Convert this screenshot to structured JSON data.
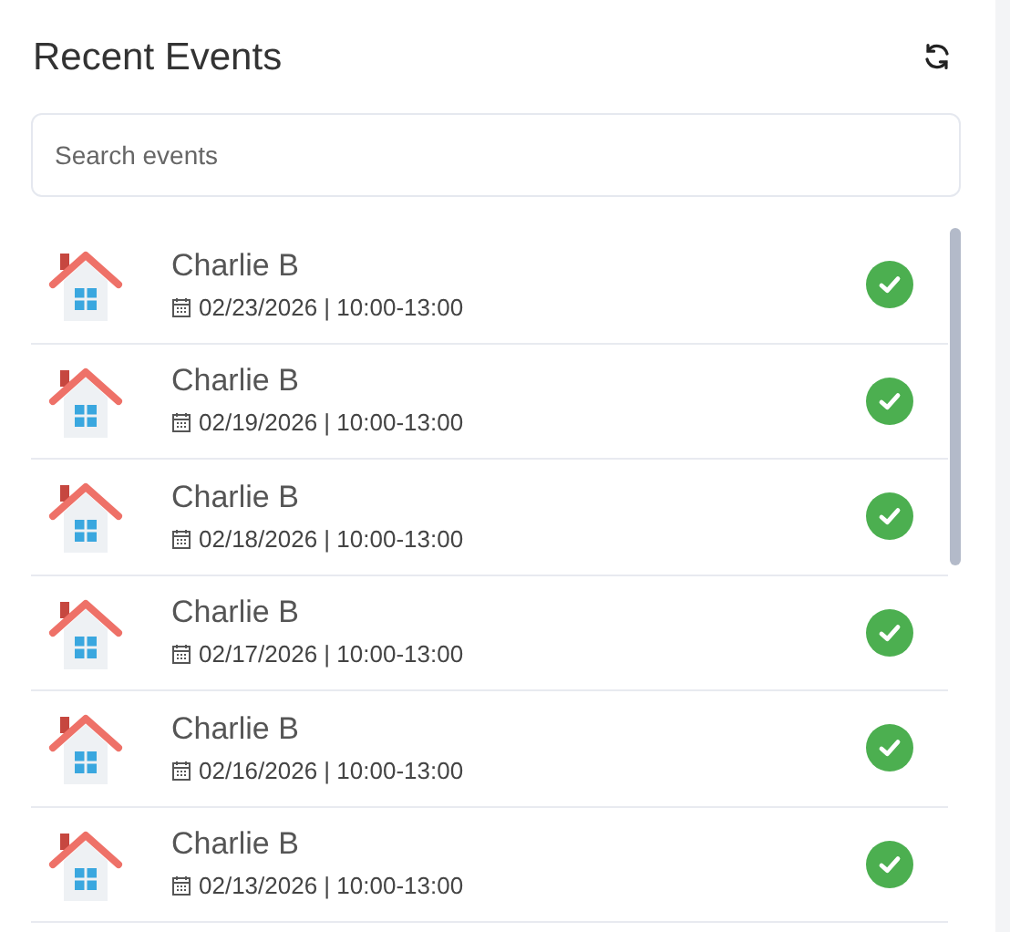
{
  "title": "Recent Events",
  "search": {
    "placeholder": "Search events"
  },
  "events": [
    {
      "name": "Charlie B",
      "when": "02/23/2026 | 10:00-13:00",
      "done": true
    },
    {
      "name": "Charlie B",
      "when": "02/19/2026 | 10:00-13:00",
      "done": true
    },
    {
      "name": "Charlie B",
      "when": "02/18/2026 | 10:00-13:00",
      "done": true
    },
    {
      "name": "Charlie B",
      "when": "02/17/2026 | 10:00-13:00",
      "done": true
    },
    {
      "name": "Charlie B",
      "when": "02/16/2026 | 10:00-13:00",
      "done": true
    },
    {
      "name": "Charlie B",
      "when": "02/13/2026 | 10:00-13:00",
      "done": true
    }
  ]
}
